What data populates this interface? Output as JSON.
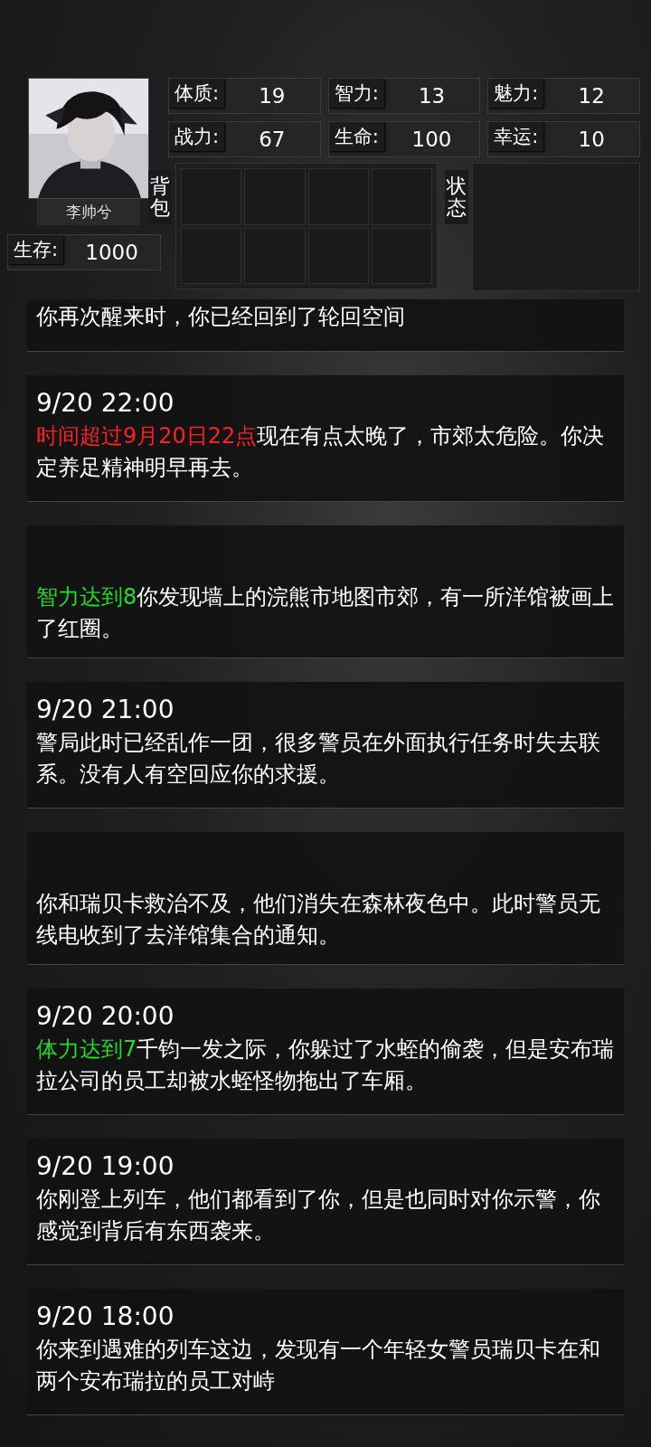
{
  "character": {
    "name": "李帅兮",
    "kind": "picture"
  },
  "stats": [
    {
      "label": "体质:",
      "value": "19"
    },
    {
      "label": "智力:",
      "value": "13"
    },
    {
      "label": "魅力:",
      "value": "12"
    },
    {
      "label": "战力:",
      "value": "67"
    },
    {
      "label": "生命:",
      "value": "100"
    },
    {
      "label": "幸运:",
      "value": "10"
    }
  ],
  "survival": {
    "label": "生存:",
    "value": "1000"
  },
  "backpack": {
    "label": "背包"
  },
  "status": {
    "label": "状态"
  },
  "log": [
    {
      "text": "你再次醒来时，你已经回到了轮回空间",
      "cut": true
    },
    {
      "time": "9/20 22:00",
      "check": {
        "text": "时间超过9月20日22点",
        "kind": "fail"
      },
      "text": "现在有点太晚了，市郊太危险。你决定养足精神明早再去。"
    },
    {
      "check": {
        "text": "智力达到8",
        "kind": "pass"
      },
      "text": "你发现墙上的浣熊市地图市郊，有一所洋馆被画上了红圈。"
    },
    {
      "time": "9/20 21:00",
      "text": "警局此时已经乱作一团，很多警员在外面执行任务时失去联系。没有人有空回应你的求援。"
    },
    {
      "text": "你和瑞贝卡救治不及，他们消失在森林夜色中。此时警员无线电收到了去洋馆集合的通知。"
    },
    {
      "time": "9/20 20:00",
      "check": {
        "text": "体力达到7",
        "kind": "pass"
      },
      "text": "千钧一发之际，你躲过了水蛭的偷袭，但是安布瑞拉公司的员工却被水蛭怪物拖出了车厢。"
    },
    {
      "time": "9/20 19:00",
      "text": "你刚登上列车，他们都看到了你，但是也同时对你示警，你感觉到背后有东西袭来。"
    },
    {
      "time": "9/20 18:00",
      "text": "你来到遇难的列车这边，发现有一个年轻女警员瑞贝卡在和两个安布瑞拉的员工对峙"
    }
  ]
}
